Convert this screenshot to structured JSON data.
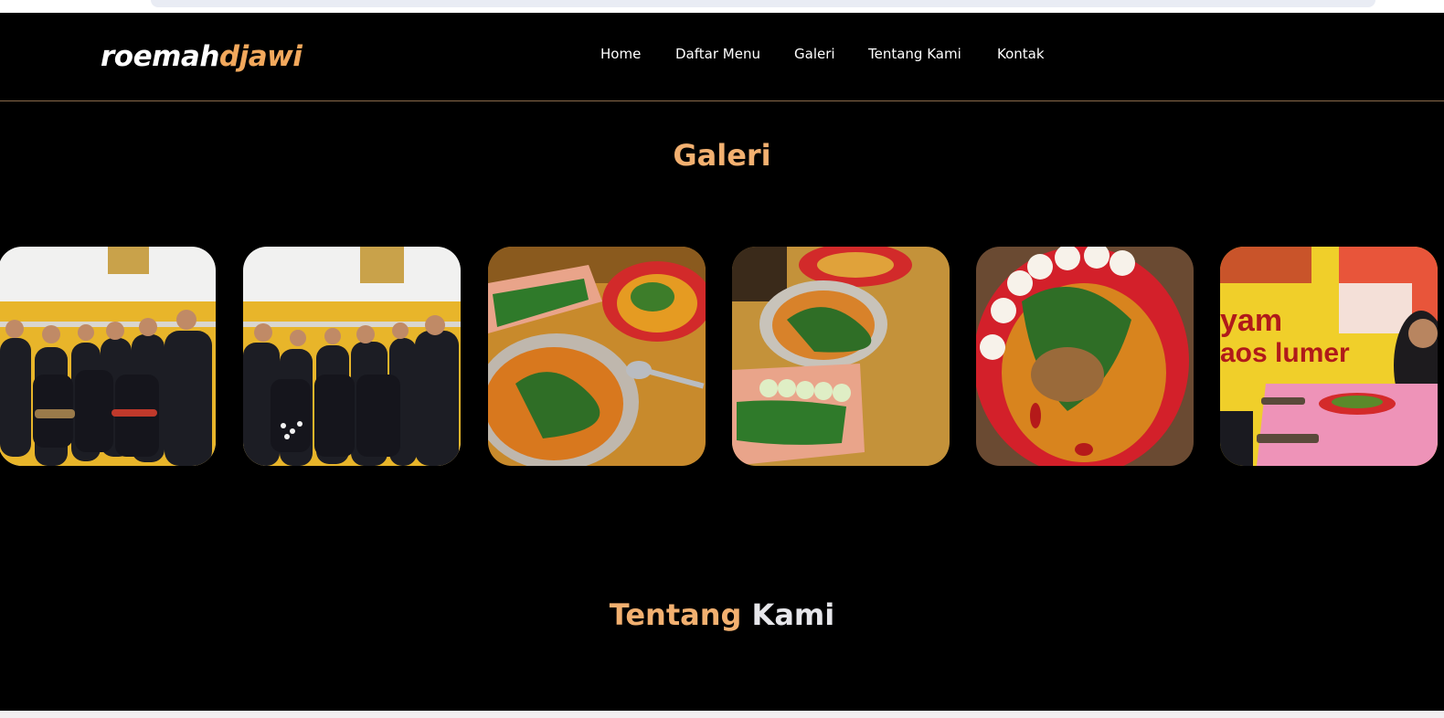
{
  "brand": {
    "part1": "roemah",
    "part2": "djawi"
  },
  "nav": {
    "home": "Home",
    "menu": "Daftar Menu",
    "galeri": "Galeri",
    "tentang": "Tentang Kami",
    "kontak": "Kontak"
  },
  "gallery": {
    "title": "Galeri",
    "items": [
      {
        "alt": "group-photo"
      },
      {
        "alt": "group-photo"
      },
      {
        "alt": "food-plates"
      },
      {
        "alt": "food-plates"
      },
      {
        "alt": "curry-plate"
      },
      {
        "alt": "banner-photo",
        "banner_text_1": "yam",
        "banner_text_2": "aos lumer"
      }
    ]
  },
  "about": {
    "title_part1": "Tentang",
    "title_part2": "Kami"
  },
  "colors": {
    "accent": "#f2a85c",
    "background": "#000000"
  }
}
